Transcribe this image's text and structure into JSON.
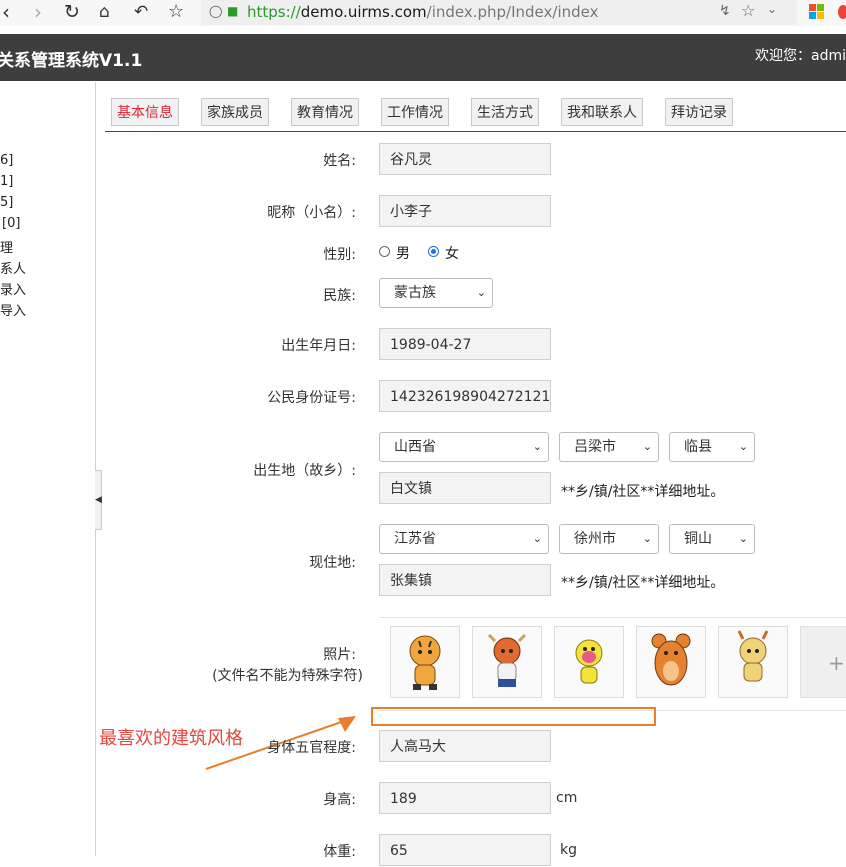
{
  "browser": {
    "url_scheme": "https://",
    "url_host": "demo.uirms.com",
    "url_path": "/index.php/Index/index"
  },
  "header": {
    "app_title": "关系管理系统V1.1",
    "welcome": "欢迎您：admi"
  },
  "sidebar": {
    "items": [
      "6]",
      "1]",
      "5]",
      "[0]",
      "理",
      "系人",
      "录入",
      "导入"
    ]
  },
  "tabs": [
    {
      "label": "基本信息",
      "active": true
    },
    {
      "label": "家族成员",
      "active": false
    },
    {
      "label": "教育情况",
      "active": false
    },
    {
      "label": "工作情况",
      "active": false
    },
    {
      "label": "生活方式",
      "active": false
    },
    {
      "label": "我和联系人",
      "active": false
    },
    {
      "label": "拜访记录",
      "active": false
    }
  ],
  "form": {
    "name_label": "姓名:",
    "name_value": "谷凡灵",
    "nickname_label": "昵称（小名）:",
    "nickname_value": "小李子",
    "gender_label": "性别:",
    "gender_options": [
      "男",
      "女"
    ],
    "gender_selected": "女",
    "ethnicity_label": "民族:",
    "ethnicity_value": "蒙古族",
    "birthdate_label": "出生年月日:",
    "birthdate_value": "1989-04-27",
    "id_label": "公民身份证号:",
    "id_value": "142326198904272121",
    "birthplace_label": "出生地（故乡）:",
    "birthplace_province": "山西省",
    "birthplace_city": "吕梁市",
    "birthplace_county": "临县",
    "birthplace_town": "白文镇",
    "address_hint": "**乡/镇/社区**详细地址。",
    "residence_label": "现住地:",
    "residence_province": "江苏省",
    "residence_city": "徐州市",
    "residence_county": "铜山",
    "residence_town": "张集镇",
    "photo_label": "照片:",
    "photo_hint": "(文件名不能为特殊字符)",
    "photo_add": "+",
    "appearance_label": "身体五官程度:",
    "appearance_value": "人高马大",
    "height_label": "身高:",
    "height_value": "189",
    "height_unit": "cm",
    "weight_label": "体重:",
    "weight_value": "65",
    "weight_unit": "kg"
  },
  "annotation": {
    "text": "最喜欢的建筑风格",
    "color": "#e8463c",
    "arrow_color": "#e87f2e"
  }
}
